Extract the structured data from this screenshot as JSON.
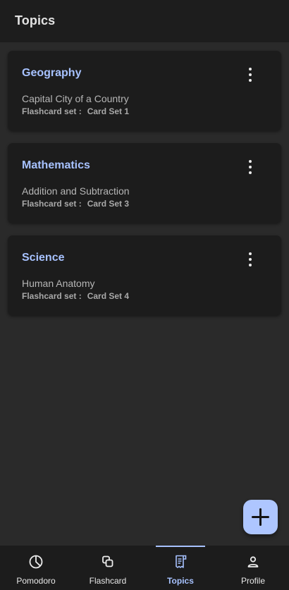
{
  "header": {
    "title": "Topics"
  },
  "topics": [
    {
      "title": "Geography",
      "subtitle": "Capital City of a Country",
      "meta_label": "Flashcard set :",
      "meta_value": "Card Set 1"
    },
    {
      "title": "Mathematics",
      "subtitle": "Addition and Subtraction",
      "meta_label": "Flashcard set :",
      "meta_value": "Card Set 3"
    },
    {
      "title": "Science",
      "subtitle": "Human Anatomy",
      "meta_label": "Flashcard set :",
      "meta_value": "Card Set 4"
    }
  ],
  "fab": {
    "icon": "plus-icon"
  },
  "nav": {
    "active": "Topics",
    "items": [
      {
        "label": "Pomodoro",
        "icon": "pie-chart-icon"
      },
      {
        "label": "Flashcard",
        "icon": "cards-icon"
      },
      {
        "label": "Topics",
        "icon": "receipt-list-icon"
      },
      {
        "label": "Profile",
        "icon": "person-icon"
      }
    ]
  },
  "colors": {
    "background": "#2a2a2a",
    "header": "#1d1d1d",
    "card": "#1c1c1c",
    "accent": "#a7c2ff",
    "fab": "#aec6ff"
  }
}
